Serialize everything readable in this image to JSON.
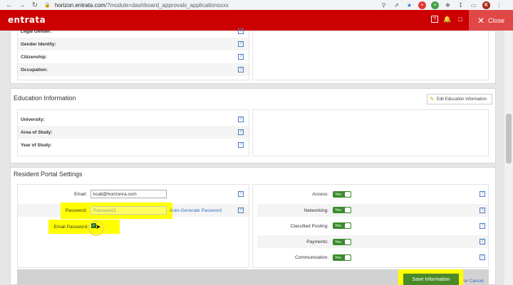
{
  "browser": {
    "url_domain": "horizon.entrata.com",
    "url_path": "/?module=dashboard_approvals_applicationsxxx",
    "profile_initial": "K"
  },
  "header": {
    "logo": "entrata",
    "close_label": "Close"
  },
  "personal": {
    "rows": [
      {
        "label": "Legal Gender:"
      },
      {
        "label": "Gender Identity:"
      },
      {
        "label": "Citizenship:"
      },
      {
        "label": "Occupation:"
      }
    ]
  },
  "education": {
    "title": "Education Information",
    "edit_label": "Edit Education Information",
    "rows": [
      {
        "label": "University:"
      },
      {
        "label": "Area of Study:"
      },
      {
        "label": "Year of Study:"
      }
    ]
  },
  "portal": {
    "title": "Resident Portal Settings",
    "email_label": "Email:",
    "email_value": "kcall@horizonra.com",
    "password_label": "Password:",
    "password_value": "Password1",
    "auto_generate": "Auto-Generate Password",
    "email_password_label": "Email Password:",
    "settings": [
      {
        "label": "Access:",
        "value": "Yes"
      },
      {
        "label": "Networking:",
        "value": "Yes"
      },
      {
        "label": "Classified Posting:",
        "value": "Yes"
      },
      {
        "label": "Payments:",
        "value": "Yes"
      },
      {
        "label": "Communication:",
        "value": "Yes"
      }
    ],
    "save_label": "Save Information",
    "or_text": "or",
    "cancel_label": "Cancel"
  },
  "colors": {
    "brand_red": "#cc0000",
    "toggle_green": "#3c8a2e",
    "highlight": "#ffff00"
  }
}
